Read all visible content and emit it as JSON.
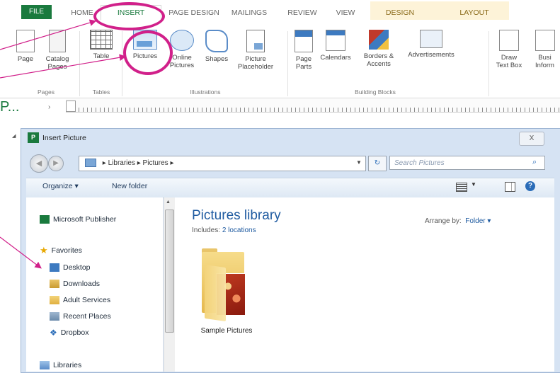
{
  "ribbon_tabs": {
    "file": "FILE",
    "home": "HOME",
    "insert": "INSERT",
    "page_design": "PAGE DESIGN",
    "mailings": "MAILINGS",
    "review": "REVIEW",
    "view": "VIEW",
    "design": "DESIGN",
    "layout": "LAYOUT"
  },
  "ribbon": {
    "pages_group": {
      "label": "Pages",
      "page": "Page",
      "catalog": "Catalog",
      "catalog2": "Pages"
    },
    "tables_group": {
      "label": "Tables",
      "table": "Table"
    },
    "illustrations_group": {
      "label": "Illustrations",
      "pictures": "Pictures",
      "online": "Online",
      "online2": "Pictures",
      "shapes": "Shapes",
      "placeholder": "Picture",
      "placeholder2": "Placeholder"
    },
    "blocks_group": {
      "label": "Building Blocks",
      "parts": "Page",
      "parts2": "Parts",
      "calendars": "Calendars",
      "borders": "Borders &",
      "borders2": "Accents",
      "ads": "Advertisements"
    },
    "draw": "Draw",
    "draw2": "Text Box",
    "busi": "Busi",
    "busi2": "Inform"
  },
  "pages_panel_label": "P...",
  "dialog": {
    "title": "Insert Picture",
    "close": "X",
    "address": {
      "part1": "Libraries",
      "part2": "Pictures"
    },
    "search_placeholder": "Search Pictures",
    "organize": "Organize",
    "new_folder": "New folder",
    "nav": {
      "publisher": "Microsoft Publisher",
      "favorites": "Favorites",
      "desktop": "Desktop",
      "downloads": "Downloads",
      "adult_services": "Adult Services",
      "recent_places": "Recent Places",
      "dropbox": "Dropbox",
      "libraries": "Libraries"
    },
    "library_title": "Pictures library",
    "includes_label": "Includes:",
    "includes_link": "2 locations",
    "arrange_label": "Arrange by:",
    "arrange_value": "Folder",
    "folder_name": "Sample Pictures"
  },
  "colors": {
    "accent_green": "#1a7a3e",
    "annotation_magenta": "#d1208a",
    "dialog_frame": "#d6e3f3"
  }
}
